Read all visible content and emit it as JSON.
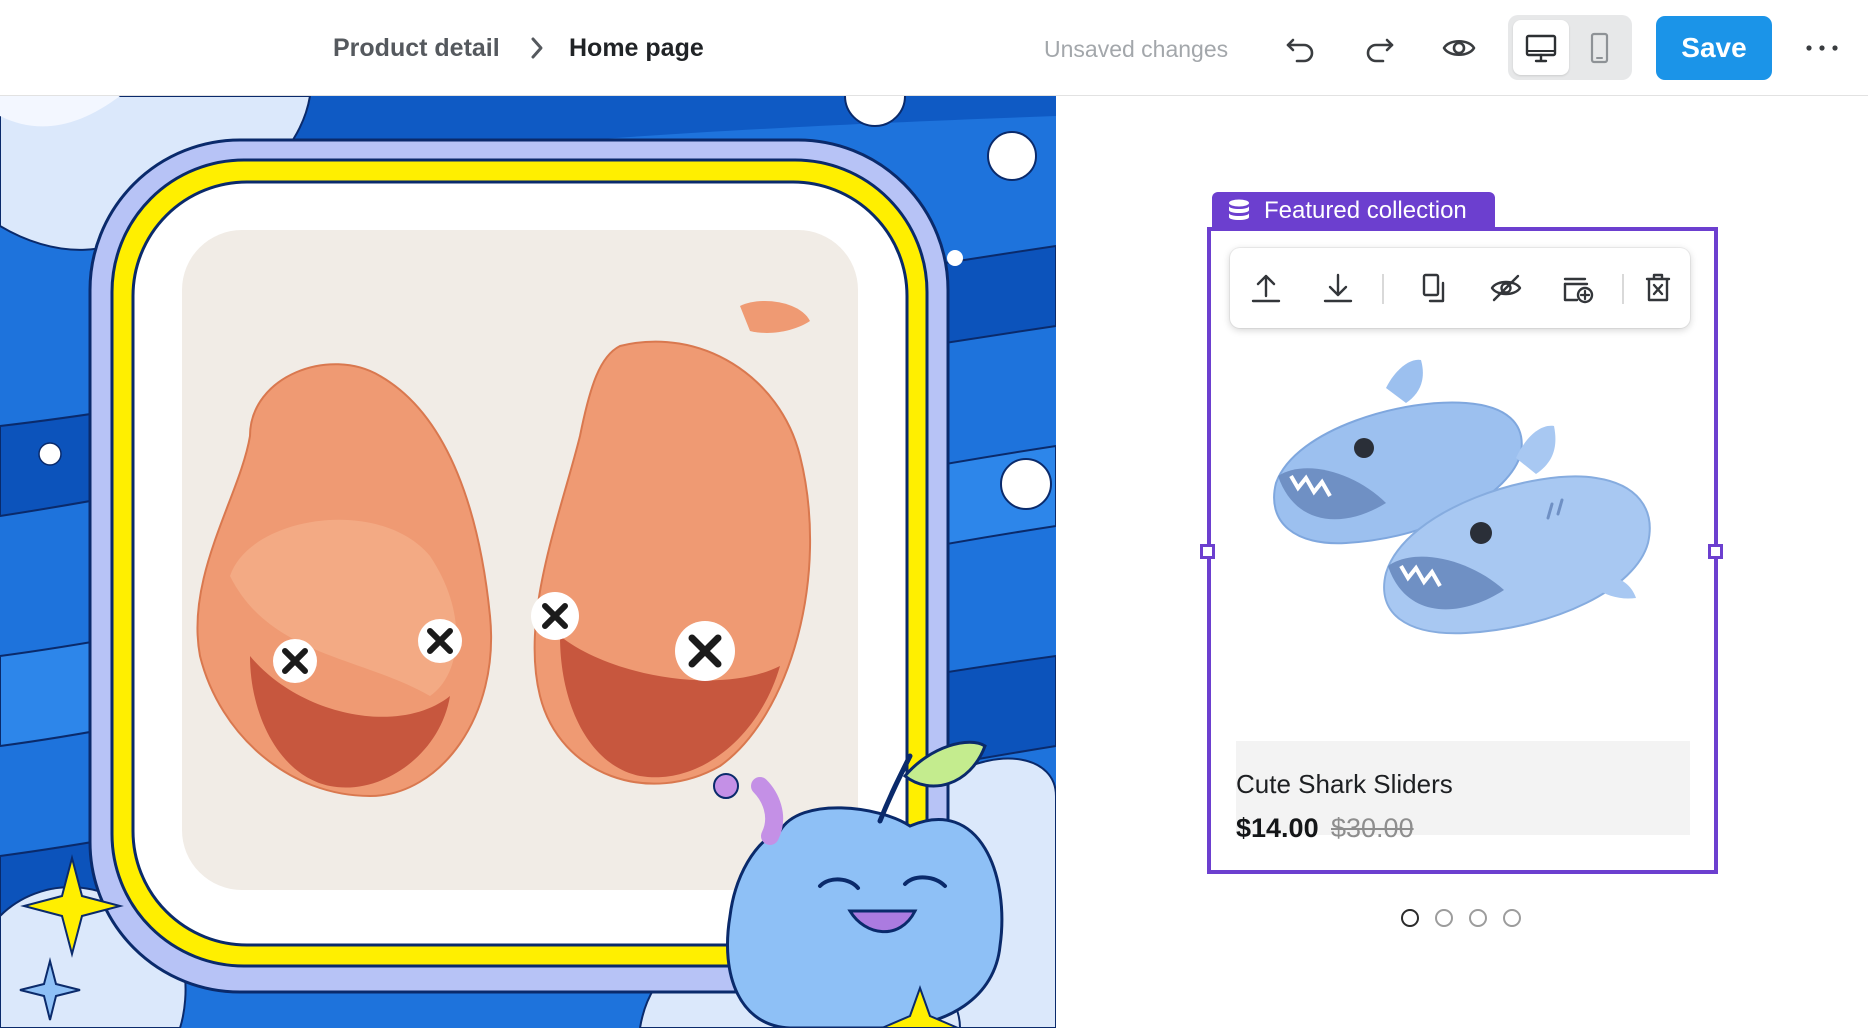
{
  "header": {
    "breadcrumb": [
      "Product detail",
      "Home page"
    ],
    "status_text": "Unsaved changes",
    "save_label": "Save",
    "actions": [
      "undo-icon",
      "redo-icon",
      "eye-icon"
    ],
    "device_options": [
      "desktop-icon",
      "mobile-icon"
    ],
    "selected_device": "desktop"
  },
  "section": {
    "tag_label": "Featured collection",
    "tag_icon": "database-icon",
    "accent_color": "#6c3fcf",
    "toolbar_actions": [
      "move-up-icon",
      "move-down-icon",
      "duplicate-icon",
      "hide-icon",
      "add-section-icon",
      "delete-icon"
    ]
  },
  "product": {
    "title": "Cute Shark Sliders",
    "price": "$14.00",
    "compare_at_price": "$30.00"
  },
  "carousel": {
    "page_count": 4,
    "active_index": 0
  },
  "colors": {
    "save_button": "#1b94e8",
    "selection": "#6c3fcf"
  }
}
